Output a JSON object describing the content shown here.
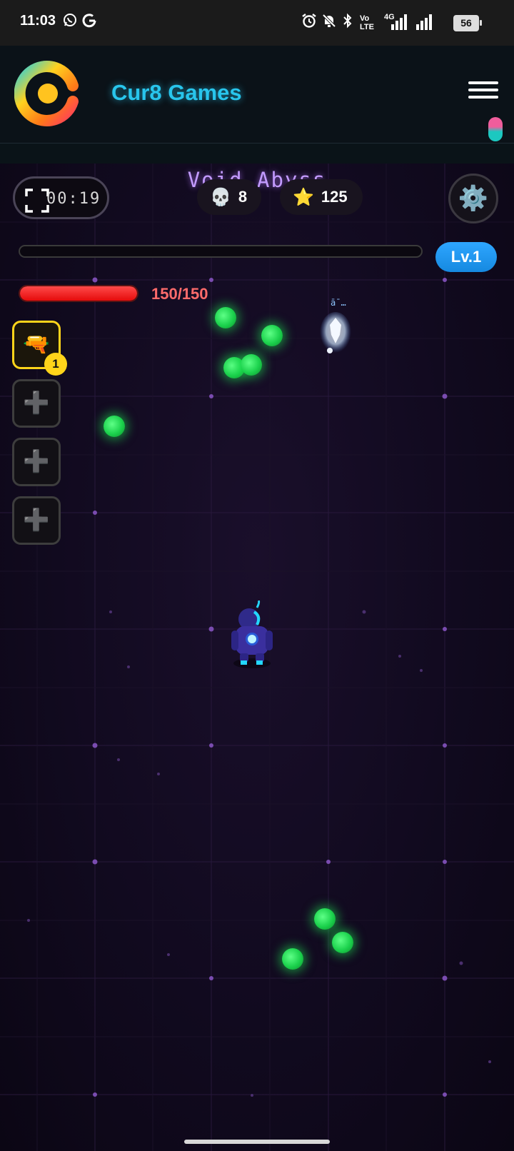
{
  "status_bar": {
    "time": "11:03",
    "network_label": "Vo LTE",
    "network_gen": "4G",
    "battery": "56",
    "icons": [
      "whatsapp-icon",
      "google-icon",
      "alarm-icon",
      "mute-icon",
      "bluetooth-icon",
      "signal-icon"
    ]
  },
  "app_bar": {
    "brand": "Cur8 Games",
    "menu_icon": "hamburger-icon",
    "accent_color": "#28c5ec"
  },
  "hud": {
    "timer": "00:19",
    "level_name": "Void Abyss",
    "kills": "8",
    "kills_icon": "skull-icon",
    "stars": "125",
    "stars_icon": "star-icon",
    "settings_icon": "gear-icon",
    "xp_progress": 0.0,
    "level_badge": "Lv.1",
    "hp_text": "150/150",
    "hp_fraction": 1.0
  },
  "weapon_slots": [
    {
      "icon": "🔫",
      "state": "filled",
      "level": "1"
    },
    {
      "icon": "➕",
      "state": "empty",
      "level": ""
    },
    {
      "icon": "➕",
      "state": "empty",
      "level": ""
    },
    {
      "icon": "➕",
      "state": "empty",
      "level": ""
    }
  ],
  "enemy_tag": "ā¯…"
}
